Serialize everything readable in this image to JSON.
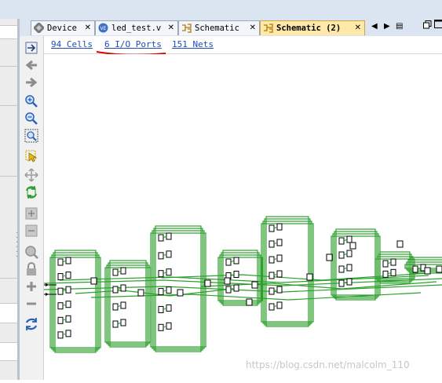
{
  "tabs": [
    {
      "label": "Device",
      "icon": "device-icon",
      "close": "✕"
    },
    {
      "label": "led_test.v",
      "icon": "verilog-file-icon",
      "close": "✕"
    },
    {
      "label": "Schematic",
      "icon": "schematic-icon",
      "close": "✕"
    },
    {
      "label": "Schematic (2)",
      "icon": "schematic-icon",
      "close": "✕",
      "active": true
    }
  ],
  "info": {
    "cells": "94 Cells",
    "ports": "6 I/O Ports",
    "nets": "151 Nets"
  },
  "toolbar": [
    "fit-selection-icon",
    "back-icon",
    "forward-icon",
    "zoom-in-icon",
    "zoom-out-icon",
    "zoom-fit-icon",
    "select-area-icon",
    "pan-icon",
    "refresh-icon",
    "expand-icon",
    "collapse-icon",
    "search-icon",
    "lock-icon",
    "add-icon",
    "remove-icon",
    "regenerate-icon"
  ],
  "watermark": "https://blog.csdn.net/malcolm_110",
  "colors": {
    "wire": "#2ca02c",
    "cell": "#000000",
    "link": "#1e4eb5",
    "annotation": "#e00000"
  }
}
